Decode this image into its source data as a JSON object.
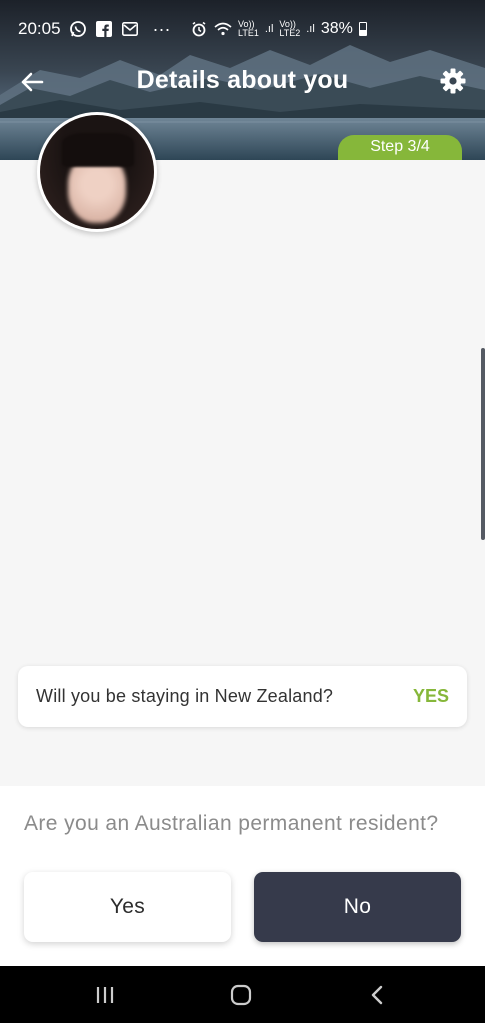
{
  "status_bar": {
    "time": "20:05",
    "battery": "38%",
    "lte1": "LTE1",
    "lte2": "LTE2",
    "volte": "Vo))",
    "more": "···"
  },
  "header": {
    "title": "Details about you",
    "step": "Step 3/4"
  },
  "card": {
    "question": "Will you be staying in New Zealand?",
    "answer": "YES"
  },
  "prompt": {
    "question": "Are you an Australian permanent resident?",
    "yes_label": "Yes",
    "no_label": "No"
  },
  "colors": {
    "accent_green": "#86b73a",
    "dark_button": "#363a4b"
  },
  "icons": {
    "back": "arrow-left-icon",
    "settings": "gear-icon",
    "nav_recent": "recent-apps-icon",
    "nav_home": "home-icon",
    "nav_back": "back-chevron-icon"
  }
}
